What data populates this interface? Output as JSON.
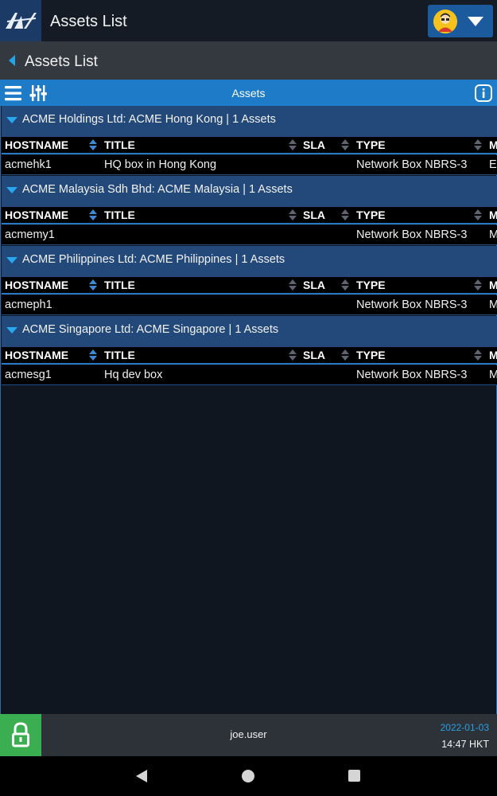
{
  "app": {
    "title": "Assets List",
    "logo_icon": "nv-logo-icon",
    "user_menu_icon": "user-avatar-icon"
  },
  "subheader": {
    "title": "Assets List"
  },
  "toolbar": {
    "title": "Assets",
    "left_icons": [
      "menu-icon",
      "filter-sliders-icon"
    ],
    "right_icon": "info-icon"
  },
  "columns": {
    "hostname": "HOSTNAME",
    "title": "TITLE",
    "sla": "SLA",
    "type": "TYPE",
    "last": "M"
  },
  "groups": [
    {
      "header": "ACME Holdings Ltd: ACME Hong Kong | 1 Assets",
      "rows": [
        {
          "hostname": "acmehk1",
          "title": "HQ box in Hong Kong",
          "sla": "",
          "type": "Network Box NBRS-3",
          "last": "E-"
        }
      ]
    },
    {
      "header": "ACME Malaysia Sdh Bhd: ACME Malaysia | 1 Assets",
      "rows": [
        {
          "hostname": "acmemy1",
          "title": "",
          "sla": "",
          "type": "Network Box NBRS-3",
          "last": "M"
        }
      ]
    },
    {
      "header": "ACME Philippines Ltd: ACME Philippines | 1 Assets",
      "rows": [
        {
          "hostname": "acmeph1",
          "title": "",
          "sla": "",
          "type": "Network Box NBRS-3",
          "last": "M"
        }
      ]
    },
    {
      "header": "ACME Singapore Ltd: ACME Singapore | 1 Assets",
      "rows": [
        {
          "hostname": "acmesg1",
          "title": "Hq dev box",
          "sla": "",
          "type": "Network Box NBRS-3",
          "last": "M"
        }
      ]
    }
  ],
  "footer": {
    "user": "joe.user",
    "date": "2022-01-03",
    "time": "14:47 HKT",
    "lock_icon": "lock-icon"
  },
  "colors": {
    "accent": "#1e7bc8",
    "group_header": "#23497a",
    "lock_button": "#3cae52",
    "date_text": "#2a9fe3"
  }
}
